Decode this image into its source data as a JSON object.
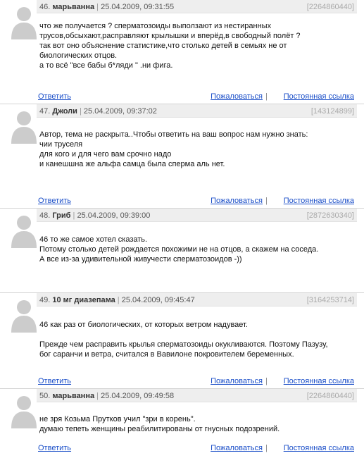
{
  "actions": {
    "reply": "Ответить",
    "complain": "Пожаловаться",
    "permalink": "Постоянная ссылка",
    "divider": "|"
  },
  "posts": [
    {
      "num": "46.",
      "author": "марьванна",
      "date": "25.04.2009, 09:31:55",
      "id": "[2264860440]",
      "lines": [
        "что же получается ? сперматозоиды выползают из нестиранных",
        "трусов,обсыхают,расправляют крылышки и вперёд,в свободный полёт ?",
        "так вот оно объяснение статистике,что столько детей в семьях не от",
        "биологических отцов.",
        "а то всё \"все бабы б*ляди \" .ни фига."
      ]
    },
    {
      "num": "47.",
      "author": "Джоли",
      "date": "25.04.2009, 09:37:02",
      "id": "[143124899]",
      "lines": [
        "Автор, тема не раскрыта..Чтобы ответить на ваш вопрос нам нужно знать:",
        "чии труселя",
        "для кого и для чего вам срочно надо",
        "и канешшна же альфа самца была сперма аль нет."
      ]
    },
    {
      "num": "48.",
      "author": "Гриб",
      "date": "25.04.2009, 09:39:00",
      "id": "[2872630340]",
      "lines": [
        "46 то же самое хотел сказать.",
        "Потому столько детей рождается похожими не на отцов, а скажем на соседа.",
        "А все из-за удивительной живучести сперматозоидов -))"
      ]
    },
    {
      "num": "49.",
      "author": "10 мг диазепама",
      "date": "25.04.2009, 09:45:47",
      "id": "[3164253714]",
      "lines": [
        "46 как раз от биологических, от которых ветром надувает.",
        "",
        "Прежде чем расправить крылья сперматозоиды окукливаются. Поэтому Пазузу,",
        "бог саранчи и ветра, считался в Вавилоне покровителем беременных."
      ]
    },
    {
      "num": "50.",
      "author": "марьванна",
      "date": "25.04.2009, 09:49:58",
      "id": "[2264860440]",
      "lines": [
        "не зря Козьма Прутков учил \"зри в корень\".",
        "думаю тепеть женщины реабилитированы от гнусных подозрений."
      ]
    }
  ]
}
